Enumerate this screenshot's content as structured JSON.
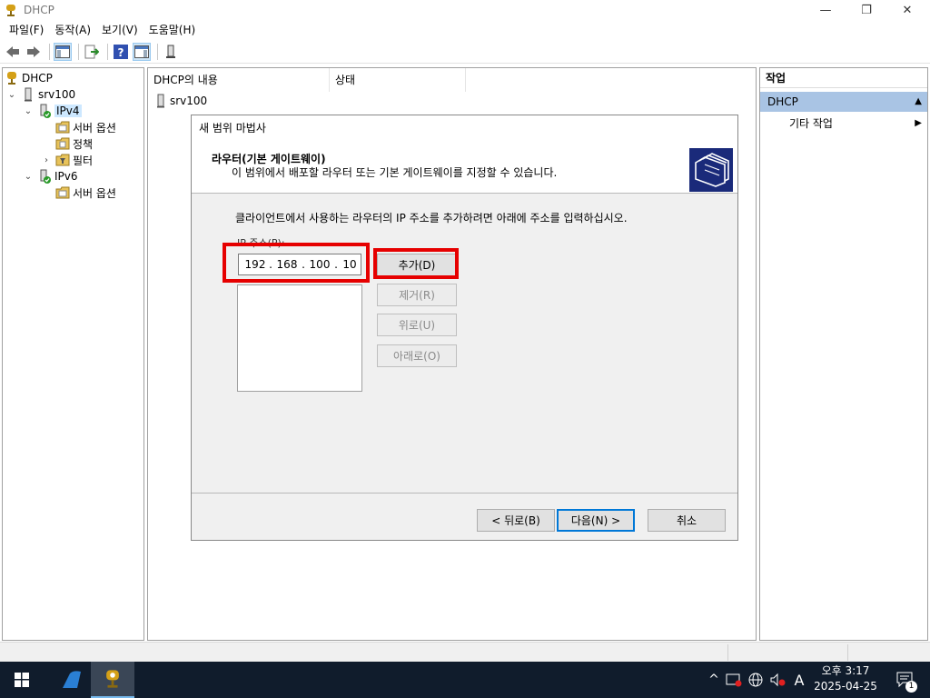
{
  "window": {
    "title": "DHCP",
    "minimize": "—",
    "restore": "❐",
    "close": "✕"
  },
  "menu": {
    "file": "파일(F)",
    "action": "동작(A)",
    "view": "보기(V)",
    "help": "도움말(H)"
  },
  "tree": {
    "root": "DHCP",
    "server": "srv100",
    "ipv4": "IPv4",
    "ipv4_server_options": "서버 옵션",
    "ipv4_policies": "정책",
    "ipv4_filters": "필터",
    "ipv6": "IPv6",
    "ipv6_server_options": "서버 옵션"
  },
  "center": {
    "col_contents": "DHCP의 내용",
    "col_status": "상태",
    "server_row": "srv100"
  },
  "wizard": {
    "title": "새 범위 마법사",
    "header_title": "라우터(기본 게이트웨이)",
    "header_subtitle": "이 범위에서 배포할 라우터 또는 기본 게이트웨이를 지정할 수 있습니다.",
    "description": "클라이언트에서 사용하는 라우터의 IP 주소를 추가하려면 아래에 주소를 입력하십시오.",
    "ip_label": "IP 주소(P):",
    "ip_octets": [
      "192",
      "168",
      "100",
      "10"
    ],
    "ip_dot": ".",
    "router_list": [],
    "add_button": "추가(D)",
    "remove_button": "제거(R)",
    "up_button": "위로(U)",
    "down_button": "아래로(O)",
    "back_button": "< 뒤로(B)",
    "next_button": "다음(N) >",
    "cancel_button": "취소"
  },
  "actions": {
    "title": "작업",
    "section": "DHCP",
    "more_actions": "기타 작업"
  },
  "taskbar": {
    "clock_time": "오후 3:17",
    "clock_date": "2025-04-25",
    "ime": "A",
    "notification_count": "1"
  },
  "colors": {
    "highlight": "#e60000",
    "selection": "#cde8ff",
    "action_section": "#a9c4e4",
    "taskbar": "#101c2c",
    "default_button_border": "#0078d7"
  }
}
